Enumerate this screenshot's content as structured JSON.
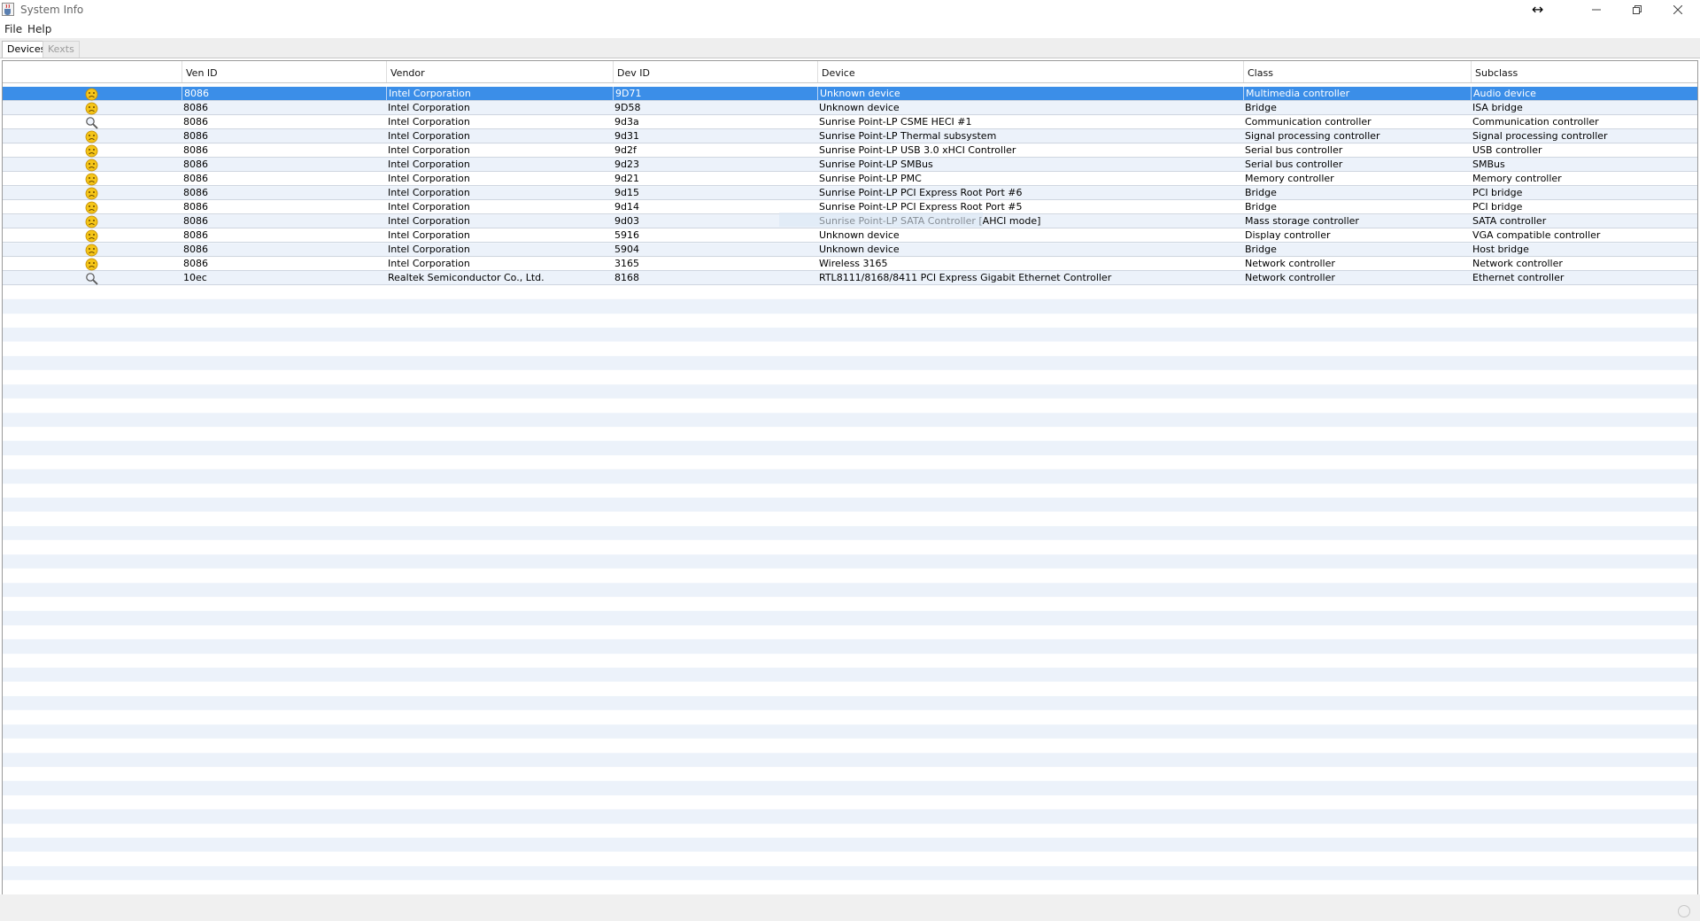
{
  "window": {
    "title": "System Info",
    "icons": {
      "app": "java-cup-icon",
      "cursor": "horizontal-resize-cursor"
    }
  },
  "menu": {
    "file": "File",
    "help": "Help"
  },
  "tabs": [
    {
      "label": "Devices",
      "active": true
    },
    {
      "label": "Kexts",
      "active": false
    }
  ],
  "table": {
    "headers": [
      "",
      "Ven ID",
      "Vendor",
      "Dev ID",
      "Device",
      "Class",
      "Subclass"
    ],
    "selected_row": 0,
    "rows": [
      {
        "icon": "sad-face-icon",
        "ven": "8086",
        "vendor": "Intel Corporation",
        "dev": "9D71",
        "device": "Unknown device",
        "class": "Multimedia controller",
        "subclass": "Audio device"
      },
      {
        "icon": "sad-face-icon",
        "ven": "8086",
        "vendor": "Intel Corporation",
        "dev": "9D58",
        "device": "Unknown device",
        "class": "Bridge",
        "subclass": "ISA bridge"
      },
      {
        "icon": "magnifier-icon",
        "ven": "8086",
        "vendor": "Intel Corporation",
        "dev": "9d3a",
        "device": "Sunrise Point-LP CSME HECI #1",
        "class": "Communication controller",
        "subclass": "Communication controller"
      },
      {
        "icon": "sad-face-icon",
        "ven": "8086",
        "vendor": "Intel Corporation",
        "dev": "9d31",
        "device": "Sunrise Point-LP Thermal subsystem",
        "class": "Signal processing controller",
        "subclass": "Signal processing controller"
      },
      {
        "icon": "sad-face-icon",
        "ven": "8086",
        "vendor": "Intel Corporation",
        "dev": "9d2f",
        "device": "Sunrise Point-LP USB 3.0 xHCI Controller",
        "class": "Serial bus controller",
        "subclass": "USB controller"
      },
      {
        "icon": "sad-face-icon",
        "ven": "8086",
        "vendor": "Intel Corporation",
        "dev": "9d23",
        "device": "Sunrise Point-LP SMBus",
        "class": "Serial bus controller",
        "subclass": "SMBus"
      },
      {
        "icon": "sad-face-icon",
        "ven": "8086",
        "vendor": "Intel Corporation",
        "dev": "9d21",
        "device": "Sunrise Point-LP PMC",
        "class": "Memory controller",
        "subclass": "Memory controller"
      },
      {
        "icon": "sad-face-icon",
        "ven": "8086",
        "vendor": "Intel Corporation",
        "dev": "9d15",
        "device": "Sunrise Point-LP PCI Express Root Port #6",
        "class": "Bridge",
        "subclass": "PCI bridge"
      },
      {
        "icon": "sad-face-icon",
        "ven": "8086",
        "vendor": "Intel Corporation",
        "dev": "9d14",
        "device": "Sunrise Point-LP PCI Express Root Port #5",
        "class": "Bridge",
        "subclass": "PCI bridge"
      },
      {
        "icon": "sad-face-icon",
        "ven": "8086",
        "vendor": "Intel Corporation",
        "dev": "9d03",
        "device": "Sunrise Point-LP SATA Controller [AHCI mode]",
        "class": "Mass storage controller",
        "subclass": "SATA controller"
      },
      {
        "icon": "sad-face-icon",
        "ven": "8086",
        "vendor": "Intel Corporation",
        "dev": "5916",
        "device": "Unknown device",
        "class": "Display controller",
        "subclass": "VGA compatible controller"
      },
      {
        "icon": "sad-face-icon",
        "ven": "8086",
        "vendor": "Intel Corporation",
        "dev": "5904",
        "device": "Unknown device",
        "class": "Bridge",
        "subclass": "Host bridge"
      },
      {
        "icon": "sad-face-icon",
        "ven": "8086",
        "vendor": "Intel Corporation",
        "dev": "3165",
        "device": "Wireless 3165",
        "class": "Network controller",
        "subclass": "Network controller"
      },
      {
        "icon": "magnifier-icon",
        "ven": "10ec",
        "vendor": "Realtek Semiconductor Co., Ltd.",
        "dev": "8168",
        "device": "RTL8111/8168/8411 PCI Express Gigabit Ethernet Controller",
        "class": "Network controller",
        "subclass": "Ethernet controller"
      }
    ]
  },
  "colors": {
    "selection": "#3b8ee8",
    "stripe": "#ecf2fa",
    "face": "#f5c518"
  }
}
